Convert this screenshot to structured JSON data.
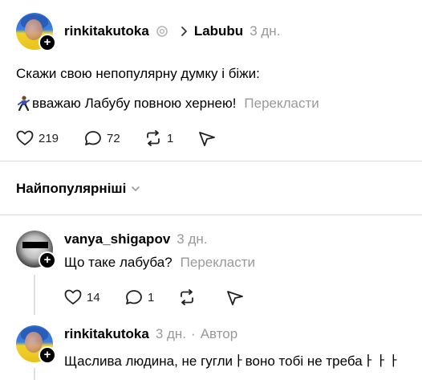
{
  "post": {
    "author": "rinkitakutoka",
    "breadcrumb_sep": "›",
    "community": "Labubu",
    "time": "3 дн.",
    "title": "Скажи свою непопулярну думку і біжи:",
    "body": "вважаю Лабубу повною хернею!",
    "translate": "Перекласти",
    "likes": "219",
    "comments": "72",
    "reposts": "1"
  },
  "sort": {
    "label": "Найпопулярніші"
  },
  "replies": [
    {
      "author": "vanya_shigapov",
      "time": "3 дн.",
      "text": "Що таке лабуба?",
      "translate": "Перекласти",
      "likes": "14",
      "comments": "1"
    },
    {
      "author": "rinkitakutoka",
      "time": "3 дн.",
      "separator": "·",
      "badge": "Автор",
      "text": "Щаслива людина, не гуглиￂвоно тобі не требаￂￂￂ"
    }
  ],
  "colors": {
    "muted": "#999999",
    "divider": "#dcdcdc",
    "plus_bg": "#000000"
  }
}
